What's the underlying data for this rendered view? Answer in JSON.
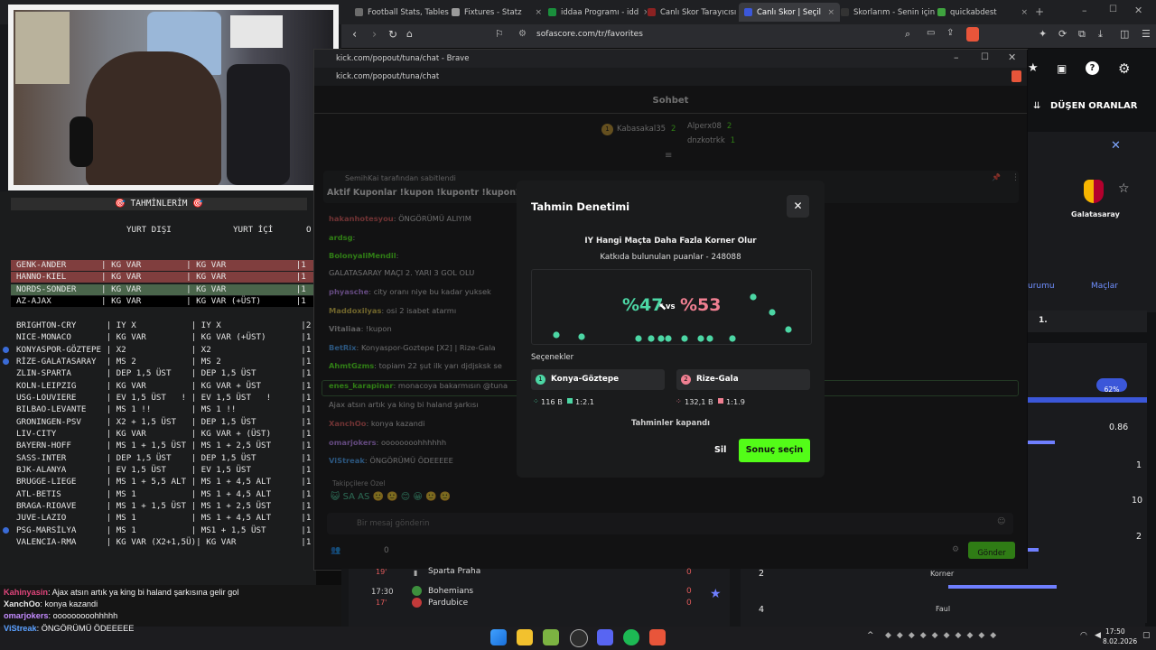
{
  "browser": {
    "tabs": [
      {
        "label": "Football Stats, Tables",
        "color": "#6c6c6c",
        "active": false
      },
      {
        "label": "Fixtures - Statz",
        "color": "#9a9a9a",
        "active": false
      },
      {
        "label": "iddaa Programı - idd",
        "color": "#1a8f3c",
        "active": false
      },
      {
        "label": "Canlı Skor Tarayıcısı",
        "color": "#8c2222",
        "active": false
      },
      {
        "label": "Canlı Skor | Seçil",
        "color": "#3b57d9",
        "active": true
      },
      {
        "label": "Skorlarım - Senin için",
        "color": "#333333",
        "active": false
      },
      {
        "label": "quickabdest",
        "color": "#3fa33f",
        "active": false
      }
    ],
    "url": "sofascore.com/tr/favorites"
  },
  "predictions": {
    "title": "🎯  TAHMİNLERİM  🎯",
    "col_dis": "YURT DIŞI",
    "col_ic": "YURT İÇİ",
    "col_extra": "O",
    "group1": [
      {
        "text": "GENK-ANDER       | KG VAR         | KG VAR              |1",
        "hl": "#a34a4a"
      },
      {
        "text": "HANNO-KIEL       | KG VAR         | KG VAR              |1",
        "hl": "#a34a4a"
      },
      {
        "text": "NORDS-SONDER     | KG VAR         | KG VAR              |1",
        "hl": "#5b7d5b"
      },
      {
        "text": "AZ-AJAX          | KG VAR         | KG VAR (+ÜST)       |1",
        "hl": "#000000"
      }
    ],
    "group2": [
      "BRIGHTON-CRY      | IY X           | IY X                |2",
      "NICE-MONACO       | KG VAR         | KG VAR (+ÜST)       |1",
      "KONYASPOR-GÖZTEPE | X2             | X2                  |1",
      "RİZE-GALATASARAY  | MS 2           | MS 2                |1",
      "ZLIN-SPARTA       | DEP 1,5 ÜST    | DEP 1,5 ÜST         |1",
      "KOLN-LEIPZIG      | KG VAR         | KG VAR + ÜST        |1",
      "USG-LOUVIERE      | EV 1,5 ÜST   ! | EV 1,5 ÜST   !      |1",
      "BILBAO-LEVANTE    | MS 1 !!        | MS 1 !!             |1",
      "GRONINGEN-PSV     | X2 + 1,5 ÜST   | DEP 1,5 ÜST         |1",
      "LIV-CITY          | KG VAR         | KG VAR + (ÜST)      |1",
      "BAYERN-HOFF       | MS 1 + 1,5 ÜST | MS 1 + 2,5 ÜST      |1",
      "SASS-INTER        | DEP 1,5 ÜST    | DEP 1,5 ÜST         |1",
      "BJK-ALANYA        | EV 1,5 ÜST     | EV 1,5 ÜST          |1",
      "BRUGGE-LIEGE      | MS 1 + 5,5 ALT | MS 1 + 4,5 ALT      |1",
      "ATL-BETIS         | MS 1           | MS 1 + 4,5 ALT      |1",
      "BRAGA-RIOAVE      | MS 1 + 1,5 ÜST | MS 1 + 2,5 ÜST      |1",
      "JUVE-LAZIO        | MS 1           | MS 1 + 4,5 ALT      |1",
      "PSG-MARSİLYA      | MS 1           | MS1 + 1,5 ÜST       |1",
      "VALENCIA-RMA      | KG VAR (X2+1,5Ü)| KG VAR             |1"
    ]
  },
  "overlay_chat": [
    {
      "user": "Kahinyasin",
      "user_color": "#e0457b",
      "msg": ": Ajax atsın artık ya king bi haland şarkısına gelir gol"
    },
    {
      "user": "XanchOo",
      "user_color": "#e8e8e8",
      "msg": ": konya kazandi"
    },
    {
      "user": "omarjokers",
      "user_color": "#c48bff",
      "msg": ": ooooooooohhhhh"
    },
    {
      "user": "ViStreak",
      "user_color": "#5aa0ff",
      "msg": ": ÖNGÖRÜMÜ ÖDEEEEE"
    }
  ],
  "kick": {
    "title": "kick.com/popout/tuna/chat - Brave",
    "url": "kick.com/popout/tuna/chat",
    "header": "Sohbet",
    "top_users": [
      {
        "rank": "1",
        "name": "Kabasakal35",
        "value": "2"
      },
      {
        "rank": "",
        "name": "Alperx08",
        "value": "2"
      },
      {
        "rank": "",
        "name": "dnzkotrkk",
        "value": "1"
      }
    ],
    "pinned_by": "SemihKai tarafından sabitlendi",
    "pinned_msg": "Aktif Kuponlar !kupon !kupontr !kupon2 !öğrene",
    "messages": [
      {
        "user": "hakanhotesyou",
        "text": "ÖNGÖRÜMÜ ALIYIM"
      },
      {
        "user": "ardsg",
        "text": ""
      },
      {
        "user": "BolonyaliMendil",
        "text": ""
      },
      {
        "user": "",
        "text": "GALATASARAY MAÇI 2. YARI 3 GOL OLU"
      },
      {
        "user": "phyasche",
        "text": "city oranı niye bu kadar yuksek"
      },
      {
        "user": "Maddoxilyas",
        "text": "osi 2 isabet atarmı"
      },
      {
        "user": "Vitaliaa",
        "text": "!kupon"
      },
      {
        "user": "BetRix",
        "text": "Konyaspor-Goztepe [X2] | Rize-Gala"
      },
      {
        "user": "AhmtGzms",
        "text": "topiam 22 şut ilk yarı djdjsksk se"
      },
      {
        "user": "enes_karapinar",
        "text": "monacoya bakarmısın @tuna"
      },
      {
        "user": "",
        "text": "Ajax atsın artık ya king bi haland şarkısı"
      },
      {
        "user": "XanchOo",
        "text": "konya kazandi"
      },
      {
        "user": "omarjokers",
        "text": "oooooooohhhhhh"
      },
      {
        "user": "ViStreak",
        "text": "ÖNGÖRÜMÜ ÖDEEEEE"
      }
    ],
    "input_placeholder": "Bir mesaj gönderin",
    "send": "Gönder",
    "viewer_count": "0",
    "followers_only": "Takipçilere Özel"
  },
  "modal": {
    "title": "Tahmin Denetimi",
    "question": "IY Hangi Maçta Daha Fazla Korner Olur",
    "contrib": "Katkıda bulunulan puanlar - 248088",
    "pct_left": "%47",
    "vs": "vs",
    "pct_right": "%53",
    "section": "Seçenekler",
    "options": [
      {
        "num": "1",
        "label": "Konya-Göztepe",
        "stat1": "116 B",
        "stat2": "1:2.1",
        "color": "#4cd6a4"
      },
      {
        "num": "2",
        "label": "Rize-Gala",
        "stat1": "132,1 B",
        "stat2": "1:1.9",
        "color": "#f07f91"
      }
    ],
    "closed": "Tahminler kapandı",
    "delete": "Sil",
    "pick": "Sonuç seçin"
  },
  "sofascore": {
    "falling_odds": "DÜŞEN ORANLAR",
    "team": "Galatasaray",
    "tab_standings": "urumu",
    "tab_matches": "Maçlar",
    "rank": "1.",
    "pct_badge": "62%",
    "stats": [
      "0.86",
      "1",
      "10",
      "2",
      "3",
      "7"
    ],
    "corner_label": "Korner",
    "foul_label": "Faul",
    "left_nums": [
      "2",
      "4"
    ],
    "matches": [
      {
        "time": "19'",
        "team": "Sparta Praha",
        "score": "0"
      },
      {
        "time": "17:30",
        "team": "Bohemians",
        "score": "0"
      },
      {
        "time": "17'",
        "team": "Pardubice",
        "score": "0"
      }
    ]
  },
  "taskbar": {
    "time": "17:50",
    "date": "8.02.2026"
  }
}
